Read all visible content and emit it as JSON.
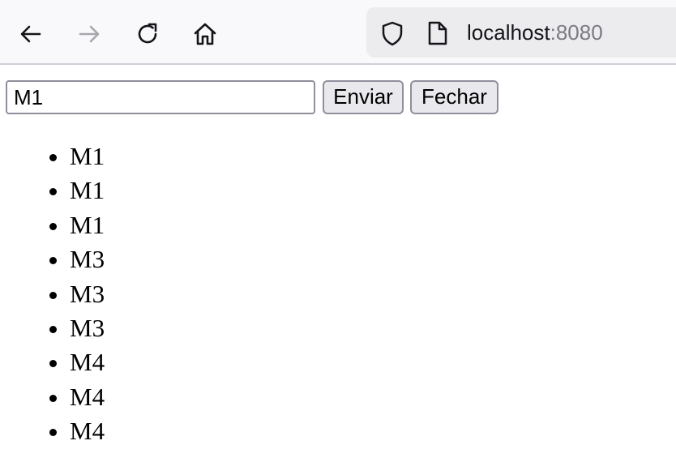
{
  "browser": {
    "url_host": "localhost",
    "url_port": ":8080",
    "icons": {
      "back": "arrow-left-icon",
      "forward": "arrow-right-icon",
      "reload": "reload-icon",
      "home": "home-icon",
      "security": "shield-icon",
      "page": "page-icon"
    }
  },
  "form": {
    "input_value": "M1",
    "send_label": "Enviar",
    "close_label": "Fechar"
  },
  "messages": [
    "M1",
    "M1",
    "M1",
    "M3",
    "M3",
    "M3",
    "M4",
    "M4",
    "M4"
  ]
}
